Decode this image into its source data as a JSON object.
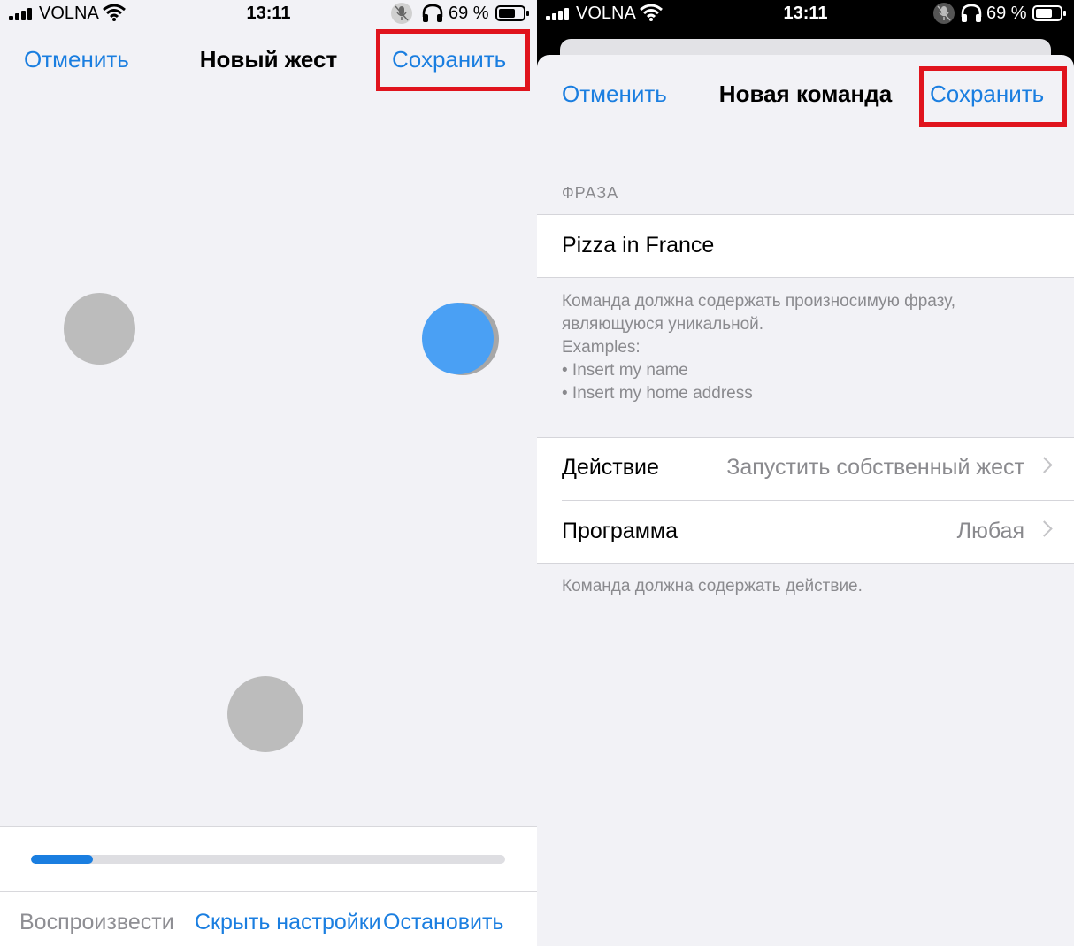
{
  "status_bar": {
    "carrier": "VOLNA",
    "time": "13:11",
    "battery_percent": "69 %",
    "battery_level": 0.69
  },
  "left": {
    "nav": {
      "cancel": "Отменить",
      "title": "Новый жест",
      "save": "Сохранить"
    },
    "gesture_progress": 0.13,
    "toolbar": {
      "play": "Воспроизвести",
      "hide_controls": "Скрыть настройки",
      "stop": "Остановить"
    }
  },
  "right": {
    "nav": {
      "cancel": "Отменить",
      "title": "Новая команда",
      "save": "Сохранить"
    },
    "phrase_header": "ФРАЗА",
    "phrase_value": "Pizza in France",
    "phrase_footer": [
      "Команда должна содержать произносимую фразу,",
      "являющуюся уникальной.",
      "Examples:",
      "• Insert my name",
      "• Insert my home address"
    ],
    "action": {
      "label": "Действие",
      "value": "Запустить собственный жест"
    },
    "app": {
      "label": "Программа",
      "value": "Любая"
    },
    "action_footer": "Команда должна содержать действие."
  },
  "colors": {
    "accent": "#1a7ee0",
    "highlight": "#e0141d",
    "touch_active": "#4aa0f4",
    "touch_inactive": "#bcbcbc"
  },
  "icons": [
    "signal-icon",
    "wifi-icon",
    "mute-icon",
    "headphones-icon",
    "battery-icon",
    "chevron-right-icon"
  ]
}
